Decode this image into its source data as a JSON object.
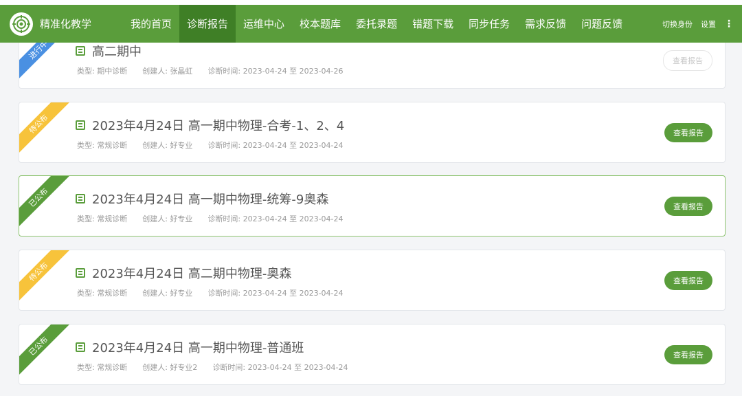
{
  "app": {
    "title": "精准化教学"
  },
  "nav": [
    {
      "label": "我的首页",
      "active": false
    },
    {
      "label": "诊断报告",
      "active": true
    },
    {
      "label": "运维中心",
      "active": false
    },
    {
      "label": "校本题库",
      "active": false
    },
    {
      "label": "委托录题",
      "active": false
    },
    {
      "label": "错题下载",
      "active": false
    },
    {
      "label": "同步任务",
      "active": false
    },
    {
      "label": "需求反馈",
      "active": false
    },
    {
      "label": "问题反馈",
      "active": false
    }
  ],
  "topright": {
    "switch": "切换身份",
    "settings": "设置",
    "more": "⋮"
  },
  "colors": {
    "brand": "#5a9d3b",
    "pending": "#f7c33b",
    "published": "#5a9d3b",
    "progress": "#4a90e2"
  },
  "reports": [
    {
      "status": "进行中",
      "status_color": "#4a90e2",
      "title": "高二期中",
      "type_label": "类型:",
      "type": "期中诊断",
      "creator_label": "创建人:",
      "creator": "张晶虹",
      "time_label": "诊断时间:",
      "time": "2023-04-24 至 2023-04-26",
      "button": "查看报告",
      "button_enabled": false
    },
    {
      "status": "待公布",
      "status_color": "#f7c33b",
      "title": "2023年4月24日 高一期中物理-合考-1、2、4",
      "type_label": "类型:",
      "type": "常规诊断",
      "creator_label": "创建人:",
      "creator": "好专业",
      "time_label": "诊断时间:",
      "time": "2023-04-24 至 2023-04-24",
      "button": "查看报告",
      "button_enabled": true
    },
    {
      "status": "已公布",
      "status_color": "#5a9d3b",
      "title": "2023年4月24日 高一期中物理-统筹-9奥森",
      "type_label": "类型:",
      "type": "常规诊断",
      "creator_label": "创建人:",
      "creator": "好专业",
      "time_label": "诊断时间:",
      "time": "2023-04-24 至 2023-04-24",
      "button": "查看报告",
      "button_enabled": true
    },
    {
      "status": "待公布",
      "status_color": "#f7c33b",
      "title": "2023年4月24日 高二期中物理-奥森",
      "type_label": "类型:",
      "type": "常规诊断",
      "creator_label": "创建人:",
      "creator": "好专业",
      "time_label": "诊断时间:",
      "time": "2023-04-24 至 2023-04-24",
      "button": "查看报告",
      "button_enabled": true
    },
    {
      "status": "已公布",
      "status_color": "#5a9d3b",
      "title": "2023年4月24日 高一期中物理-普通班",
      "type_label": "类型:",
      "type": "常规诊断",
      "creator_label": "创建人:",
      "creator": "好专业2",
      "time_label": "诊断时间:",
      "time": "2023-04-24 至 2023-04-24",
      "button": "查看报告",
      "button_enabled": true
    }
  ]
}
